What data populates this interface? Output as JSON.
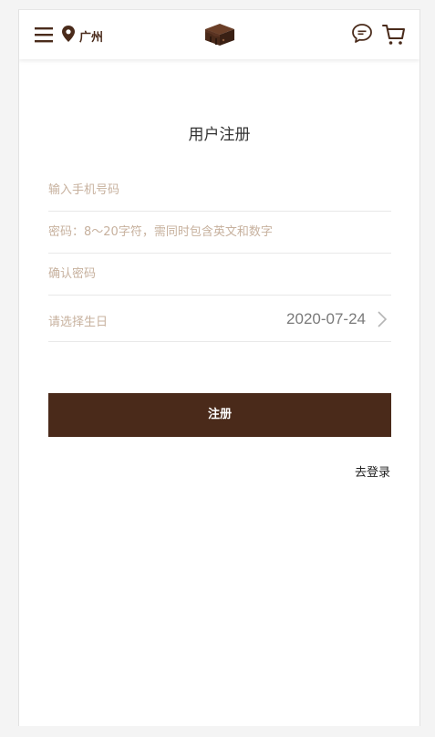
{
  "header": {
    "city": "广州",
    "icons": {
      "menu": "hamburger-menu-icon",
      "location": "location-pin-icon",
      "logo": "cake-logo",
      "chat": "chat-bubble-icon",
      "cart": "shopping-cart-icon"
    }
  },
  "page": {
    "title": "用户注册"
  },
  "form": {
    "phone_placeholder": "输入手机号码",
    "password_placeholder": "密码：8～20字符，需同时包含英文和数字",
    "confirm_placeholder": "确认密码",
    "birthday_label": "请选择生日",
    "birthday_value": "2020-07-24",
    "submit_label": "注册",
    "login_link": "去登录"
  },
  "colors": {
    "brand_brown": "#4a2a1a",
    "placeholder": "#c7b19e"
  }
}
